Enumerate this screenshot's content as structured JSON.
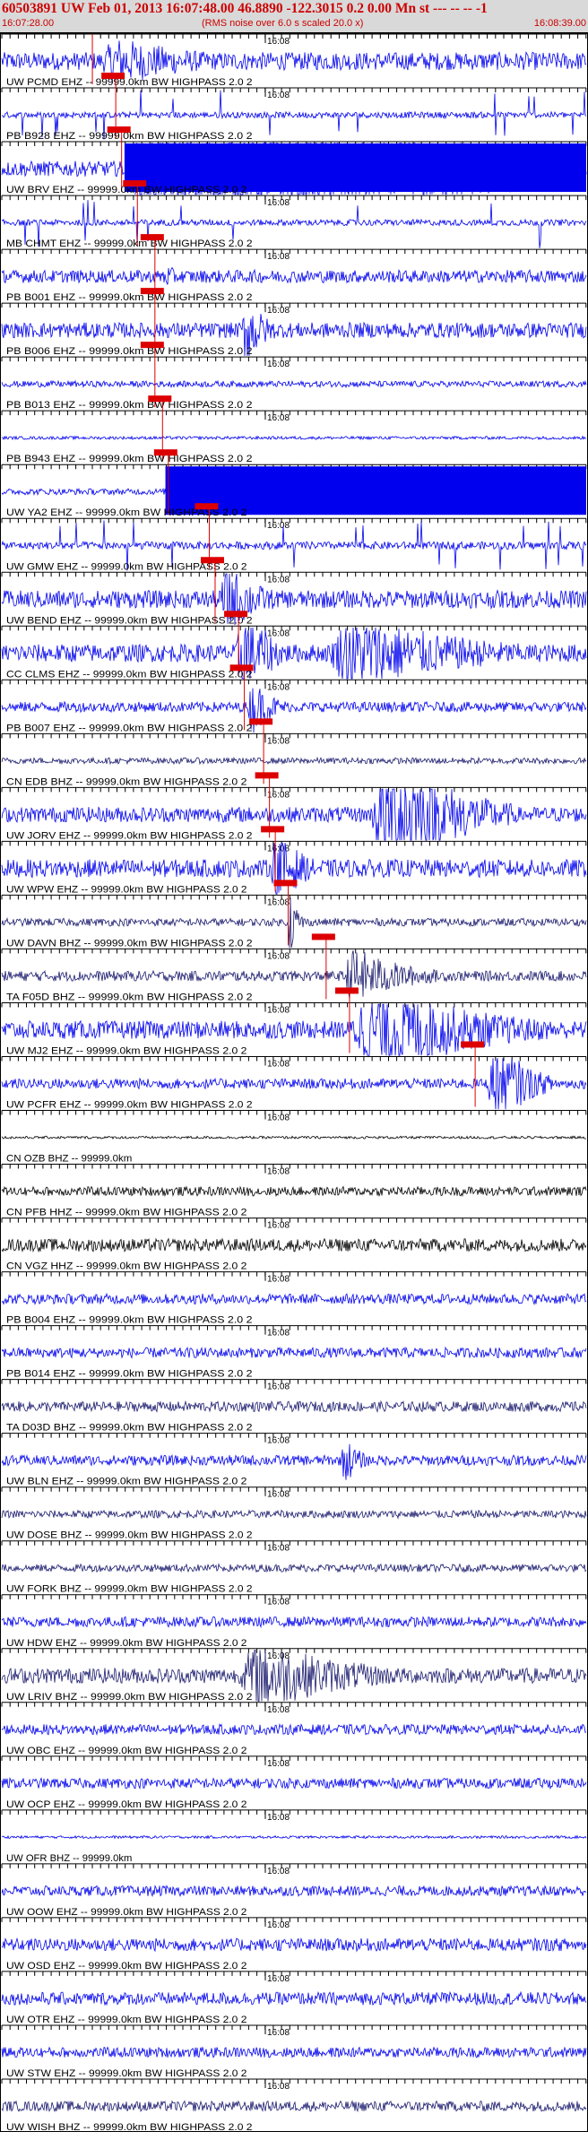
{
  "header": {
    "title": "60503891 UW Feb 01, 2013 16:07:48.00   46.8890 -122.3015  0.2 0.00 Mn st --- -- --   -1",
    "start_time": "16:07:28.00",
    "rms_note": "(RMS noise over 6.0 s scaled 20.0 x)",
    "end_time": "16:08:39.00"
  },
  "colors": {
    "trace": "#0000ee",
    "trace_dark": "#1a1a6e",
    "black_trace": "#000000",
    "pick": "#dd0000",
    "axis": "#000000"
  },
  "chart_data": {
    "type": "seismogram",
    "time_start": "16:07:28.00",
    "time_end": "16:08:39.00",
    "mid_tick_label": "16:08",
    "rows": [
      {
        "label": "UW PCMD EHZ -- 99999.0km BW  HIGHPASS  2.0  2",
        "amp": 0.35,
        "color": "blue",
        "events": [
          [
            0.16,
            0.5,
            1.0
          ]
        ],
        "pick": 0.155,
        "mid_label": "16:08"
      },
      {
        "label": "PB B928 EHZ -- 99999.0km BW  HIGHPASS  2.0  2",
        "amp": 0.12,
        "color": "blue",
        "spikes": true,
        "events": [],
        "pick": 0.195,
        "mid_label": "16:08"
      },
      {
        "label": "UW BRV EHZ -- 99999.0km BW  HIGHPASS  2.0  2",
        "amp": 0.3,
        "color": "blue",
        "events": [
          [
            0.21,
            1.0,
            5.0
          ]
        ],
        "block": [
          0.21,
          1.0
        ],
        "pick": 0.205,
        "mid_label": "16:08"
      },
      {
        "label": "MB CHMT EHZ -- 99999.0km BW  HIGHPASS  2.0  2",
        "amp": 0.12,
        "color": "blue",
        "spikes": true,
        "events": [],
        "pick": 0.232,
        "mid_label": "16:08"
      },
      {
        "label": "PB B001 EHZ -- 99999.0km BW  HIGHPASS  2.0  2",
        "amp": 0.25,
        "color": "blue",
        "events": [
          [
            0.27,
            0.35,
            0.5
          ]
        ],
        "pick": 0.262,
        "mid_label": "16:08"
      },
      {
        "label": "PB B006 EHZ -- 99999.0km BW  HIGHPASS  2.0  2",
        "amp": 0.3,
        "color": "blue",
        "events": [
          [
            0.41,
            0.48,
            1.6
          ]
        ],
        "pick": 0.262,
        "mid_label": "16:08"
      },
      {
        "label": "PB B013 EHZ -- 99999.0km BW  HIGHPASS  2.0  2",
        "amp": 0.12,
        "color": "blue",
        "events": [],
        "pick": 0.262,
        "mid_label": "16:08"
      },
      {
        "label": "PB B943 EHZ -- 99999.0km BW  HIGHPASS  2.0  2",
        "amp": 0.06,
        "color": "blue",
        "events": [],
        "pick": 0.275,
        "mid_label": "16:08"
      },
      {
        "label": "UW YA2 EHZ -- 99999.0km BW  HIGHPASS  2.0  2",
        "amp": 0.12,
        "color": "blue",
        "events": [],
        "block": [
          0.28,
          1.0
        ],
        "pick": 0.285,
        "mid_label": "16:08"
      },
      {
        "label": "UW GMW EHZ -- 99999.0km BW  HIGHPASS  2.0  2",
        "amp": 0.15,
        "color": "blue",
        "spikes": true,
        "events": [],
        "pick": 0.355,
        "mid_label": "16:08"
      },
      {
        "label": "UW BEND EHZ -- 99999.0km BW  HIGHPASS  2.0  2",
        "amp": 0.35,
        "color": "blue",
        "events": [
          [
            0.37,
            0.5,
            1.5
          ]
        ],
        "pick": 0.365,
        "mid_label": "16:08"
      },
      {
        "label": "CC CLMS EHZ -- 99999.0km BW  HIGHPASS  2.0  2",
        "amp": 0.35,
        "color": "blue",
        "events": [
          [
            0.4,
            0.5,
            2.2
          ],
          [
            0.55,
            1.0,
            1.6
          ]
        ],
        "pick": 0.405,
        "mid_label": "16:08"
      },
      {
        "label": "PB B007 EHZ -- 99999.0km BW  HIGHPASS  2.0  2",
        "amp": 0.2,
        "color": "blue",
        "events": [
          [
            0.42,
            0.5,
            1.2
          ]
        ],
        "pick": 0.415,
        "mid_label": "16:08"
      },
      {
        "label": "CN EDB BHZ -- 99999.0km BW  HIGHPASS  2.0  2",
        "amp": 0.12,
        "color": "dark",
        "events": [],
        "pick": 0.448,
        "mid_label": "16:08"
      },
      {
        "label": "UW JORV EHZ -- 99999.0km BW  HIGHPASS  2.0  2",
        "amp": 0.3,
        "color": "blue",
        "events": [
          [
            0.63,
            0.88,
            3.0
          ]
        ],
        "pick": 0.458,
        "mid_label": "16:08"
      },
      {
        "label": "UW WPW EHZ -- 99999.0km BW  HIGHPASS  2.0  2",
        "amp": 0.35,
        "color": "blue",
        "events": [
          [
            0.46,
            0.55,
            1.8
          ]
        ],
        "pick": 0.468,
        "mid_label": "16:08"
      },
      {
        "label": "UW DAVN BHZ -- 99999.0km BW  HIGHPASS  2.0  2",
        "amp": 0.15,
        "color": "dark",
        "events": [
          [
            0.49,
            0.52,
            1.5
          ]
        ],
        "pick": 0.49,
        "mid_label": "16:08"
      },
      {
        "label": "TA F05D BHZ -- 99999.0km BW  HIGHPASS  2.0  2",
        "amp": 0.2,
        "color": "dark",
        "events": [
          [
            0.58,
            0.78,
            1.2
          ]
        ],
        "pick": 0.555,
        "mid_label": "16:08"
      },
      {
        "label": "UW MJ2 EHZ -- 99999.0km BW  HIGHPASS  2.0  2",
        "amp": 0.35,
        "color": "blue",
        "events": [
          [
            0.59,
            1.0,
            2.0
          ]
        ],
        "pick": 0.595,
        "mid_label": "16:08"
      },
      {
        "label": "UW PCFR EHZ -- 99999.0km BW  HIGHPASS  2.0  2",
        "amp": 0.2,
        "color": "blue",
        "events": [
          [
            0.83,
            0.95,
            2.0
          ]
        ],
        "pick": 0.81,
        "mid_label": "16:08"
      },
      {
        "label": "CN OZB BHZ -- 99999.0km",
        "amp": 0.05,
        "color": "black",
        "events": [],
        "mid_label": "16:08"
      },
      {
        "label": "CN PFB HHZ -- 99999.0km BW  HIGHPASS  2.0  2",
        "amp": 0.18,
        "color": "black",
        "events": [],
        "mid_label": "16:08"
      },
      {
        "label": "CN VGZ HHZ -- 99999.0km BW  HIGHPASS  2.0  2",
        "amp": 0.25,
        "color": "black",
        "events": [],
        "mid_label": "16:08"
      },
      {
        "label": "PB B004 EHZ -- 99999.0km BW  HIGHPASS  2.0  2",
        "amp": 0.2,
        "color": "blue",
        "events": [],
        "mid_label": "16:08"
      },
      {
        "label": "PB B014 EHZ -- 99999.0km BW  HIGHPASS  2.0  2",
        "amp": 0.2,
        "color": "blue",
        "events": [],
        "mid_label": "16:08"
      },
      {
        "label": "TA D03D BHZ -- 99999.0km BW  HIGHPASS  2.0  2",
        "amp": 0.2,
        "color": "dark",
        "events": [],
        "mid_label": "16:08"
      },
      {
        "label": "UW BLN EHZ -- 99999.0km BW  HIGHPASS  2.0  2",
        "amp": 0.2,
        "color": "blue",
        "events": [
          [
            0.58,
            0.64,
            1.0
          ]
        ],
        "mid_label": "16:08"
      },
      {
        "label": "UW DOSE BHZ -- 99999.0km BW  HIGHPASS  2.0  2",
        "amp": 0.15,
        "color": "dark",
        "events": [],
        "mid_label": "16:08"
      },
      {
        "label": "UW FORK BHZ -- 99999.0km BW  HIGHPASS  2.0  2",
        "amp": 0.15,
        "color": "dark",
        "events": [],
        "mid_label": "16:08"
      },
      {
        "label": "UW HDW EHZ -- 99999.0km BW  HIGHPASS  2.0  2",
        "amp": 0.2,
        "color": "blue",
        "events": [],
        "mid_label": "16:08"
      },
      {
        "label": "UW LRIV BHZ -- 99999.0km BW  HIGHPASS  2.0  2",
        "amp": 0.3,
        "color": "dark",
        "events": [
          [
            0.4,
            0.75,
            1.5
          ]
        ],
        "mid_label": "16:08"
      },
      {
        "label": "UW OBC EHZ -- 99999.0km BW  HIGHPASS  2.0  2",
        "amp": 0.2,
        "color": "blue",
        "events": [],
        "mid_label": "16:08"
      },
      {
        "label": "UW OCP EHZ -- 99999.0km BW  HIGHPASS  2.0  2",
        "amp": 0.2,
        "color": "blue",
        "events": [],
        "mid_label": "16:08"
      },
      {
        "label": "UW OFR BHZ -- 99999.0km",
        "amp": 0.05,
        "color": "blue",
        "events": [],
        "mid_label": "16:08"
      },
      {
        "label": "UW OOW EHZ -- 99999.0km BW  HIGHPASS  2.0  2",
        "amp": 0.2,
        "color": "blue",
        "events": [],
        "mid_label": "16:08"
      },
      {
        "label": "UW OSD EHZ -- 99999.0km BW  HIGHPASS  2.0  2",
        "amp": 0.25,
        "color": "blue",
        "events": [],
        "mid_label": "16:08"
      },
      {
        "label": "UW OTR EHZ -- 99999.0km BW  HIGHPASS  2.0  2",
        "amp": 0.25,
        "color": "blue",
        "events": [],
        "mid_label": "16:08"
      },
      {
        "label": "UW STW EHZ -- 99999.0km BW  HIGHPASS  2.0  2",
        "amp": 0.2,
        "color": "blue",
        "events": [],
        "mid_label": "16:08"
      },
      {
        "label": "UW WISH BHZ -- 99999.0km BW  HIGHPASS  2.0  2",
        "amp": 0.2,
        "color": "dark",
        "events": [],
        "mid_label": "16:08"
      }
    ]
  }
}
